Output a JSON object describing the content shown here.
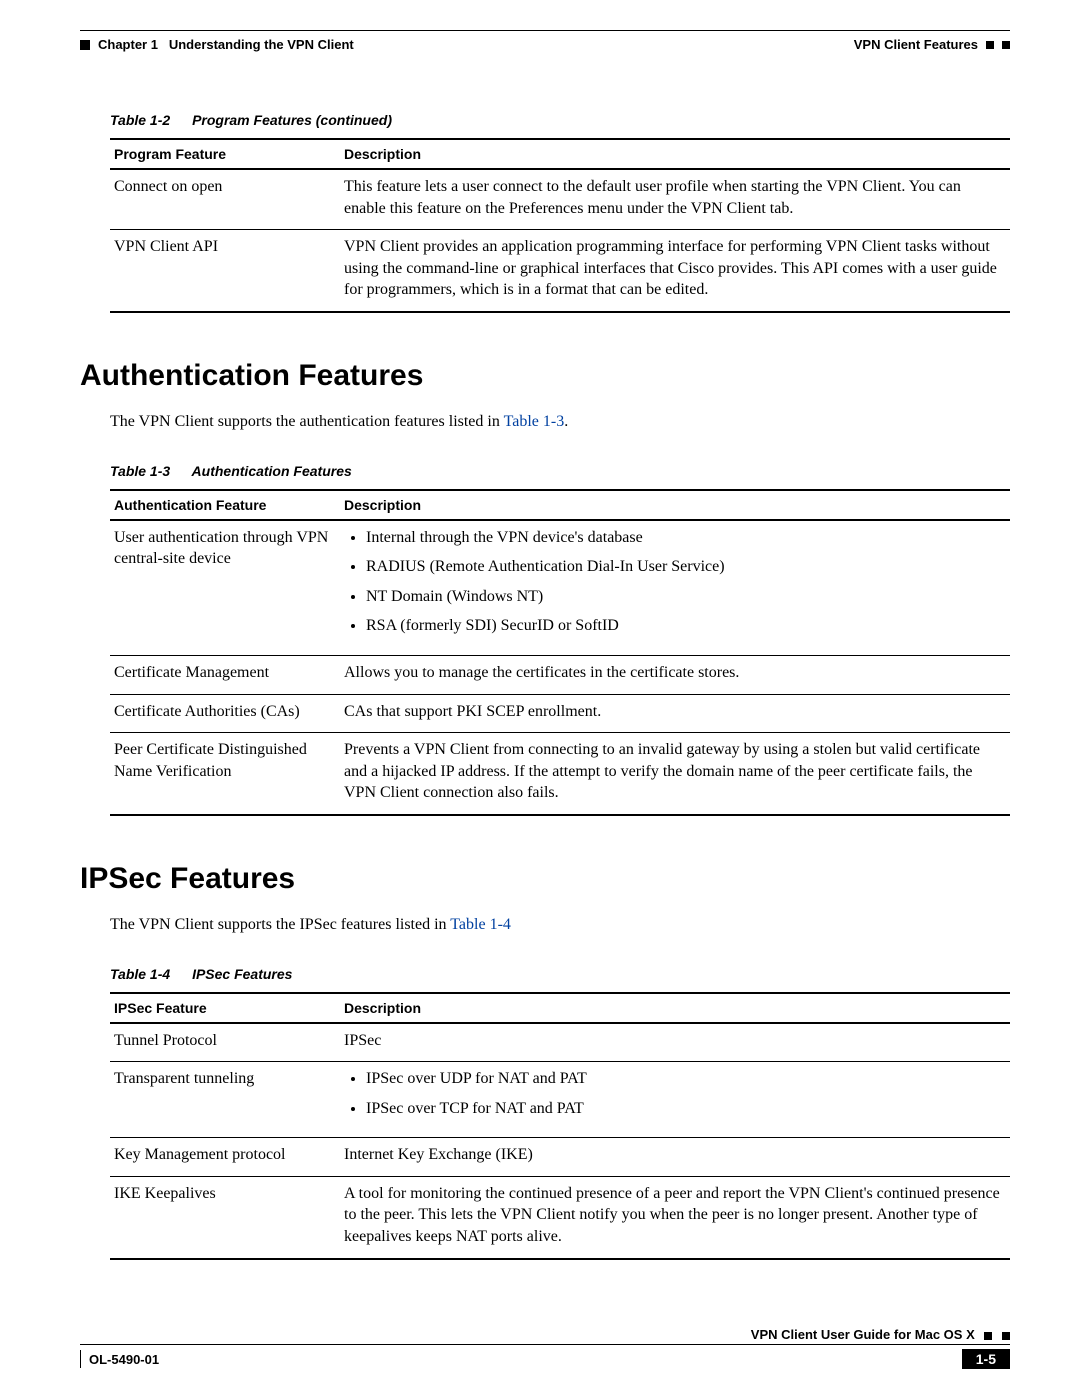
{
  "header": {
    "chapter_label": "Chapter 1",
    "chapter_title": "Understanding the VPN Client",
    "section": "VPN Client Features"
  },
  "table12": {
    "caption_num": "Table 1-2",
    "caption_title": "Program Features (continued)",
    "col1": "Program Feature",
    "col2": "Description",
    "rows": [
      {
        "feature": "Connect on open",
        "desc": "This feature lets a user connect to the default user profile when starting the VPN Client. You can enable this feature on the Preferences menu under the VPN Client tab."
      },
      {
        "feature": "VPN Client API",
        "desc": "VPN Client provides an application programming interface for performing VPN Client tasks without using the command-line or graphical interfaces that Cisco provides. This API comes with a user guide for programmers, which is in a format that can be edited."
      }
    ]
  },
  "section_auth": {
    "heading": "Authentication Features",
    "intro_prefix": "The VPN Client supports the authentication features listed in ",
    "intro_link": "Table 1-3",
    "intro_suffix": "."
  },
  "table13": {
    "caption_num": "Table 1-3",
    "caption_title": "Authentication Features",
    "col1": "Authentication Feature",
    "col2": "Description",
    "row0_feature": "User authentication through VPN central-site device",
    "row0_bullets": [
      "Internal through the VPN device's database",
      "RADIUS (Remote Authentication Dial-In User Service)",
      "NT Domain (Windows NT)",
      "RSA (formerly SDI) SecurID or SoftID"
    ],
    "row1_feature": "Certificate Management",
    "row1_desc": "Allows you to manage the certificates in the certificate stores.",
    "row2_feature": "Certificate Authorities (CAs)",
    "row2_desc": "CAs that support PKI SCEP enrollment.",
    "row3_feature": "Peer Certificate Distinguished Name Verification",
    "row3_desc": "Prevents a VPN Client from connecting to an invalid gateway by using a stolen but valid certificate and a hijacked IP address. If the attempt to verify the domain name of the peer certificate fails, the VPN Client connection also fails."
  },
  "section_ipsec": {
    "heading": "IPSec Features",
    "intro_prefix": "The VPN Client supports the IPSec features listed in ",
    "intro_link": "Table 1-4"
  },
  "table14": {
    "caption_num": "Table 1-4",
    "caption_title": "IPSec Features",
    "col1": "IPSec Feature",
    "col2": "Description",
    "row0_feature": "Tunnel Protocol",
    "row0_desc": "IPSec",
    "row1_feature": "Transparent tunneling",
    "row1_bullets": [
      "IPSec over UDP for NAT and PAT",
      "IPSec over TCP for NAT and PAT"
    ],
    "row2_feature": "Key Management protocol",
    "row2_desc": "Internet Key Exchange (IKE)",
    "row3_feature": "IKE Keepalives",
    "row3_desc": "A tool for monitoring the continued presence of a peer and report the VPN Client's continued presence to the peer. This lets the VPN Client notify you when the peer is no longer present. Another type of keepalives keeps NAT ports alive."
  },
  "footer": {
    "book": "VPN Client User Guide for Mac OS X",
    "doc_id": "OL-5490-01",
    "page": "1-5"
  }
}
